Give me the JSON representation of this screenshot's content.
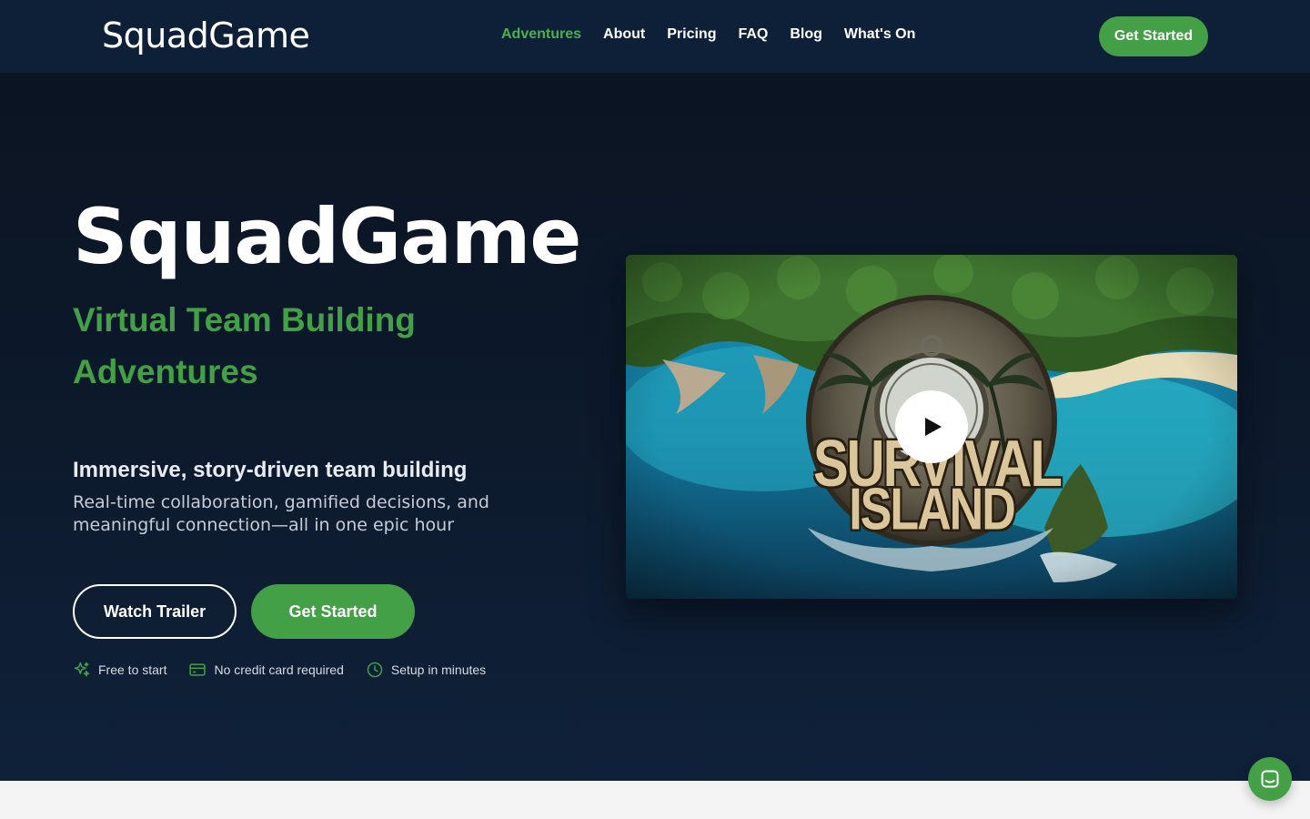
{
  "header": {
    "logo": "SquadGame",
    "nav": [
      {
        "label": "Adventures",
        "active": true
      },
      {
        "label": "About",
        "active": false
      },
      {
        "label": "Pricing",
        "active": false
      },
      {
        "label": "FAQ",
        "active": false
      },
      {
        "label": "Blog",
        "active": false
      },
      {
        "label": "What's On",
        "active": false
      }
    ],
    "cta_label": "Get Started"
  },
  "hero": {
    "title": "SquadGame",
    "subtitle": "Virtual Team Building Adventures",
    "tagline": "Immersive, story-driven team building",
    "description": "Real-time collaboration, gamified decisions, and meaningful connection—all in one epic hour",
    "watch_trailer_label": "Watch Trailer",
    "get_started_label": "Get Started",
    "features": [
      {
        "icon": "sparkles-icon",
        "label": "Free to start"
      },
      {
        "icon": "credit-card-icon",
        "label": "No credit card required"
      },
      {
        "icon": "clock-icon",
        "label": "Setup in minutes"
      }
    ]
  },
  "video": {
    "badge_line1": "SURVIVAL",
    "badge_line2": "ISLAND",
    "play_icon": "play-icon"
  },
  "colors": {
    "header_bg": "#0e2038",
    "hero_bg": "#0d1b2e",
    "accent": "#43a047",
    "text": "#ffffff"
  }
}
